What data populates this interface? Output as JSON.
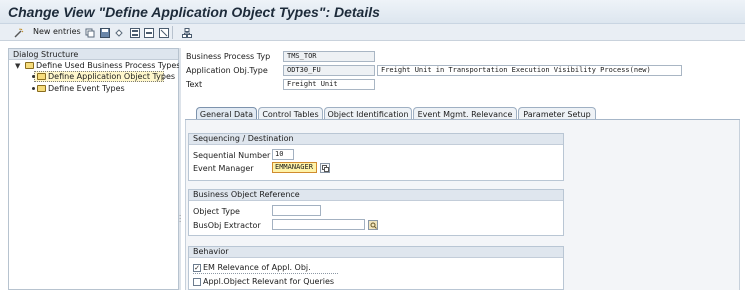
{
  "window": {
    "title": "Change View \"Define Application Object Types\": Details"
  },
  "toolbar": {
    "new_entries_label": "New entries",
    "icons": [
      "wand-icon",
      "copy-icon",
      "save-icon",
      "undo-icon",
      "select-all-icon",
      "select-block-icon",
      "deselect-icon",
      "structure-icon"
    ]
  },
  "dialog_structure": {
    "heading": "Dialog Structure",
    "items": [
      {
        "label": "Define Used Business Process Types",
        "level": 0,
        "expanded": true
      },
      {
        "label": "Define Application Object Types",
        "level": 1,
        "selected": true
      },
      {
        "label": "Define Event Types",
        "level": 1
      }
    ]
  },
  "header_fields": {
    "business_process_typ": {
      "label": "Business Process Typ",
      "value": "TMS_TOR"
    },
    "application_obj_type": {
      "label": "Application Obj.Type",
      "value": "ODT30_FU",
      "description": "Freight Unit in Transportation Execution Visibility Process(new)"
    },
    "text": {
      "label": "Text",
      "value": "Freight Unit"
    }
  },
  "tabs": [
    {
      "label": "General Data",
      "active": true
    },
    {
      "label": "Control Tables"
    },
    {
      "label": "Object Identification"
    },
    {
      "label": "Event Mgmt. Relevance"
    },
    {
      "label": "Parameter Setup"
    }
  ],
  "sequencing": {
    "title": "Sequencing / Destination",
    "sequential_number": {
      "label": "Sequential Number",
      "value": "10"
    },
    "event_manager": {
      "label": "Event Manager",
      "value": "EMMANAGER"
    }
  },
  "business_object_reference": {
    "title": "Business Object Reference",
    "object_type": {
      "label": "Object Type",
      "value": ""
    },
    "busobj_extractor": {
      "label": "BusObj Extractor",
      "value": ""
    }
  },
  "behavior": {
    "title": "Behavior",
    "em_relevance": {
      "label": "EM Relevance of Appl. Obj.",
      "checked": true
    },
    "relevant_for_queries": {
      "label": "Appl.Object Relevant for Queries",
      "checked": false
    }
  },
  "colors": {
    "title_bar": "#dde6ef",
    "panel_border": "#b7c3cf",
    "focus_field": "#fff3a8",
    "selected_tree_item": "#fff7cc"
  }
}
